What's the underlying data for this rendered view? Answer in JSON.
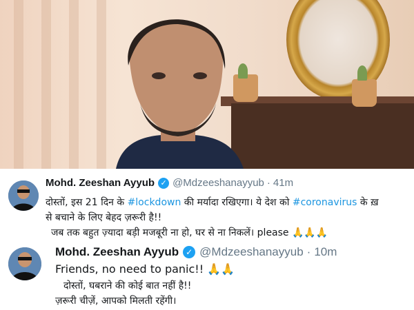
{
  "photo": {
    "alt": "person-photo"
  },
  "tweets": [
    {
      "name": "Mohd. Zeeshan Ayyub",
      "verified_icon": "verified-badge-icon",
      "handle": "@Mdzeeshanayyub",
      "separator": "·",
      "time": "41m",
      "line1": {
        "part1": "दोस्तों, इस 21 दिन के ",
        "tag1": "#lockdown",
        "part2": " की मर्यादा रखिएगा। ये देश को ",
        "tag2": "#coronavirus",
        "part3": " के ख़"
      },
      "line2": "से बचाने के लिए बेहद ज़रूरी है!!",
      "line3": "जब तक बहुत ज़्यादा बड़ी मजबूरी ना हो, घर से ना निकलें। please",
      "emoji": "🙏🙏🙏"
    },
    {
      "name": "Mohd. Zeeshan Ayyub",
      "verified_icon": "verified-badge-icon",
      "handle": "@Mdzeeshanayyub",
      "separator": "·",
      "time": "10m",
      "line1": "Friends, no need to panic!!",
      "emoji": "🙏🙏",
      "line2": "दोस्तों, घबराने की कोई बात नहीं है!!",
      "line3": "ज़रूरी चीज़ें, आपको मिलती रहेंगी।"
    }
  ],
  "colors": {
    "link": "#1b95e0",
    "verified": "#1da1f2",
    "text": "#14171a",
    "muted": "#657786"
  }
}
